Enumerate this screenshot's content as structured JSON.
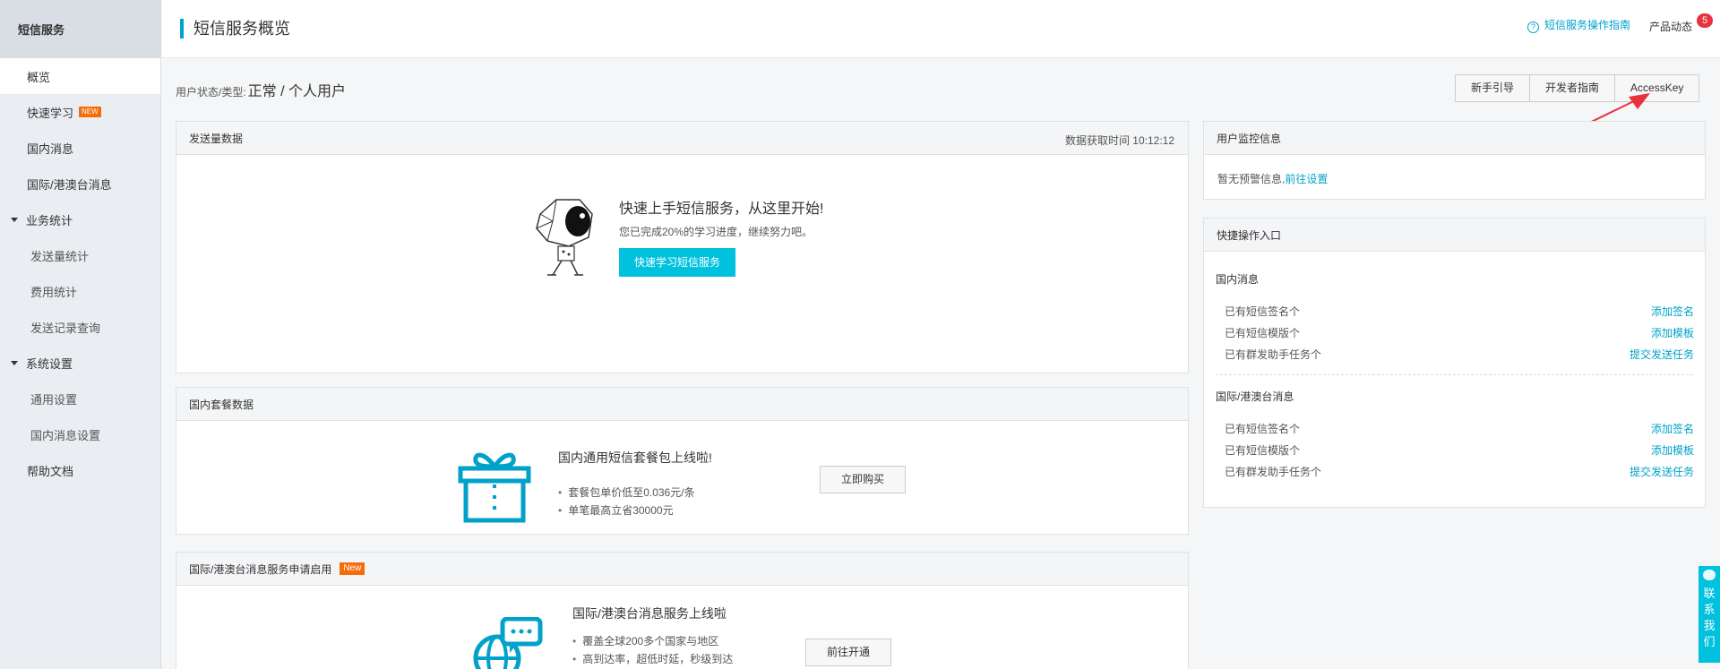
{
  "sidebar": {
    "header": "短信服务",
    "items": [
      {
        "label": "概览"
      },
      {
        "label": "快速学习",
        "badge": "NEW"
      },
      {
        "label": "国内消息"
      },
      {
        "label": "国际/港澳台消息"
      }
    ],
    "group_stats": {
      "label": "业务统计",
      "items": [
        {
          "label": "发送量统计"
        },
        {
          "label": "费用统计"
        },
        {
          "label": "发送记录查询"
        }
      ]
    },
    "group_settings": {
      "label": "系统设置",
      "items": [
        {
          "label": "通用设置"
        },
        {
          "label": "国内消息设置"
        }
      ]
    },
    "help": {
      "label": "帮助文档"
    }
  },
  "header": {
    "title": "短信服务概览",
    "guide_link": "短信服务操作指南",
    "guide_icon": "?",
    "news_link": "产品动态",
    "news_count": "5"
  },
  "status": {
    "label": "用户状态/类型:",
    "value": "正常 / 个人用户"
  },
  "toolbar": {
    "buttons": [
      "新手引导",
      "开发者指南",
      "AccessKey"
    ]
  },
  "send_panel": {
    "title": "发送量数据",
    "fetch_time": "数据获取时间 10:12:12",
    "onboard_title": "快速上手短信服务，从这里开始!",
    "onboard_sub": "您已完成20%的学习进度，继续努力吧。",
    "onboard_button": "快速学习短信服务"
  },
  "package_panel": {
    "title": "国内套餐数据",
    "headline": "国内通用短信套餐包上线啦!",
    "bullets": [
      "套餐包单价低至0.036元/条",
      "单笔最高立省30000元"
    ],
    "button": "立即购买"
  },
  "intl_panel": {
    "title": "国际/港澳台消息服务申请启用",
    "badge": "New",
    "headline": "国际/港澳台消息服务上线啦",
    "bullets": [
      "覆盖全球200多个国家与地区",
      "高到达率，超低时延，秒级到达"
    ],
    "button": "前往开通"
  },
  "monitor_panel": {
    "title": "用户监控信息",
    "text": "暂无预警信息,",
    "link": "前往设置"
  },
  "quick_panel": {
    "title": "快捷操作入口",
    "domestic": {
      "label": "国内消息",
      "rows": [
        {
          "text": "已有短信签名个",
          "action": "添加签名"
        },
        {
          "text": "已有短信模版个",
          "action": "添加模板"
        },
        {
          "text": "已有群发助手任务个",
          "action": "提交发送任务"
        }
      ]
    },
    "intl": {
      "label": "国际/港澳台消息",
      "rows": [
        {
          "text": "已有短信签名个",
          "action": "添加签名"
        },
        {
          "text": "已有短信模版个",
          "action": "添加模板"
        },
        {
          "text": "已有群发助手任务个",
          "action": "提交发送任务"
        }
      ]
    }
  },
  "contact": {
    "label": "联系我们",
    "chars": [
      "联",
      "系",
      "我",
      "们"
    ]
  },
  "colors": {
    "accent": "#00a2ca",
    "primary_button": "#00c1de",
    "badge_orange": "#f56c0b",
    "notif_red": "#e8323d",
    "annotation_arrow": "#e8323d"
  }
}
